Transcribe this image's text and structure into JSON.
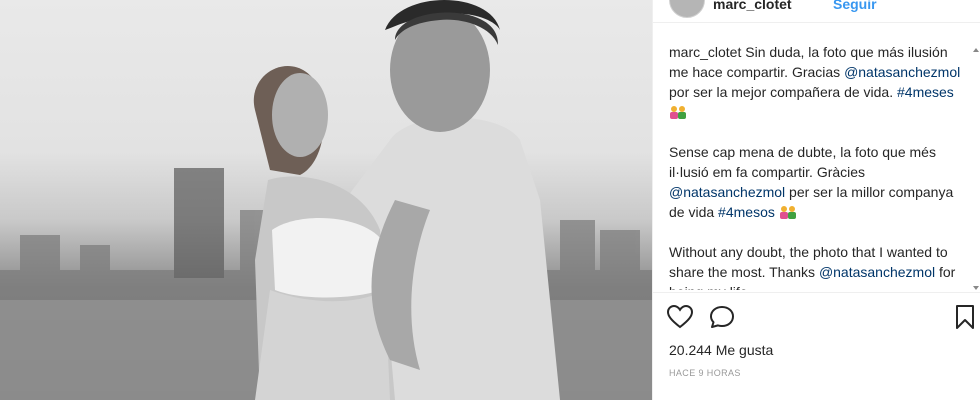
{
  "post": {
    "header_username": "marc_clotet",
    "header_follow": "Seguir",
    "caption_username": "marc_clotet",
    "caption_es_a": " Sin duda, la foto que más ilusión me hace compartir. Gracias ",
    "caption_es_mention": "@natasanchezmol",
    "caption_es_b": " por ser la mejor compañera de vida. ",
    "caption_es_tag": "#4meses",
    "caption_ca_a": "Sense cap mena de dubte, la foto que més il·lusió em fa compartir. Gràcies ",
    "caption_ca_mention": "@natasanchezmol",
    "caption_ca_b": " per ser la millor companya de vida ",
    "caption_ca_tag": "#4mesos",
    "caption_en_a": "Without any doubt, the photo that I wanted to share the most. Thanks ",
    "caption_en_mention": "@natasanchezmol",
    "caption_en_b": " for being my life",
    "likes": "20.244 Me gusta",
    "time": "HACE 9 HORAS"
  },
  "icons": {
    "like": "heart-outline-icon",
    "comment": "comment-bubble-icon",
    "save": "bookmark-outline-icon",
    "family": "family-emoji-icon"
  },
  "colors": {
    "link": "#003569",
    "text": "#262626",
    "muted": "#999999"
  }
}
